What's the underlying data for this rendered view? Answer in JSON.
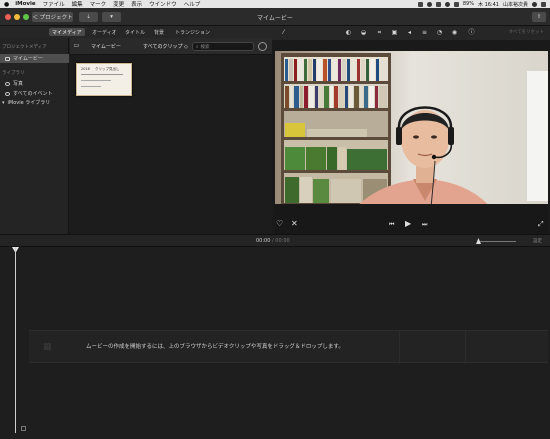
{
  "menubar": {
    "app": "iMovie",
    "items": [
      "ファイル",
      "編集",
      "マーク",
      "変更",
      "表示",
      "ウインドウ",
      "ヘルプ"
    ],
    "battery": "89%",
    "clock": "木 16:41",
    "user": "山本裕次貴"
  },
  "window": {
    "title": "マイムービー",
    "projects_button": "＜ プロジェクト"
  },
  "browser_tabs": [
    "マイメディア",
    "オーディオ",
    "タイトル",
    "背景",
    "トランジション"
  ],
  "sidebar": {
    "section_project_media": "プロジェクトメディア",
    "my_movie": "マイムービー",
    "section_library": "ライブラリ",
    "photos": "写真",
    "all_events": "すべてのイベント",
    "imovie_library": "iMovie ライブラリ"
  },
  "browser": {
    "project_label": "マイムービー",
    "filter": "すべてのクリップ ◇",
    "search_placeholder": "検索",
    "clip_title": "クリップ見出し",
    "clip_label": "2016"
  },
  "viewer": {
    "reset_label": "すべてをリセット"
  },
  "timeline": {
    "timecode_current": "00:00",
    "timecode_sep": " / ",
    "timecode_total": "00:00",
    "settings_label": "設定",
    "drop_message": "ムービーの作成を開始するには、上のブラウザからビデオクリップや写真をドラッグ＆ドロップします。",
    "playhead_position": 0
  }
}
